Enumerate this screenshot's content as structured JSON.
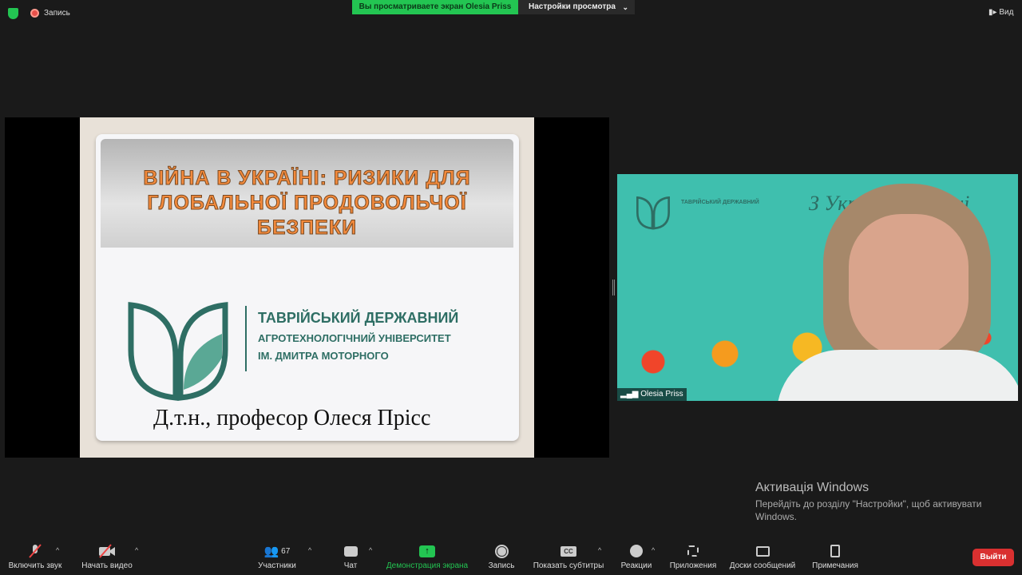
{
  "topbar": {
    "record_label": "Запись",
    "banner": "Вы просматриваете экран Olesia Priss",
    "view_settings": "Настройки просмотра",
    "view": "Вид"
  },
  "slide": {
    "title_lines": [
      "ВІЙНА В УКРАЇНІ: РИЗИКИ ДЛЯ",
      "ГЛОБАЛЬНОЇ ПРОДОВОЛЬЧОЇ",
      "БЕЗПЕКИ"
    ],
    "uni_line1": "ТАВРІЙСЬКИЙ ДЕРЖАВНИЙ",
    "uni_line2": "АГРОТЕХНОЛОГІЧНИЙ УНІВЕРСИТЕТ",
    "uni_line3": "ІМ. ДМИТРА МОТОРНОГО",
    "author": "Д.т.н., професор Олеся Прісс"
  },
  "video": {
    "participant": "Olesia Priss",
    "bg_uni": "ТАВРІЙСЬКИЙ ДЕРЖАВНИЙ",
    "bg_script": "З Україною в душі"
  },
  "watermark": {
    "title": "Активація Windows",
    "text": "Перейдіть до розділу \"Настройки\", щоб активувати Windows."
  },
  "toolbar": {
    "unmute": "Включить звук",
    "video": "Начать видео",
    "participants": "Участники",
    "participants_count": "67",
    "chat": "Чат",
    "share": "Демонстрация экрана",
    "record": "Запись",
    "captions": "Показать субтитры",
    "cc": "CC",
    "reactions": "Реакции",
    "apps": "Приложения",
    "whiteboards": "Доски сообщений",
    "notes": "Примечания",
    "leave": "Выйти"
  },
  "colors": {
    "green": "#23c552",
    "exit": "#d93030",
    "teal": "#3fbfae",
    "orange": "#f38a3c"
  }
}
